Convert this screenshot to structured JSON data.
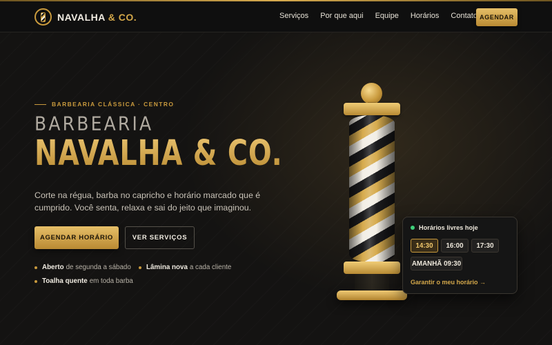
{
  "brand": {
    "name": "NAVALHA",
    "amp": "& CO.",
    "logo_icon": "barber-pole-icon"
  },
  "nav": {
    "links": [
      "Serviços",
      "Por que aqui",
      "Equipe",
      "Horários",
      "Contato"
    ],
    "cta": "AGENDAR"
  },
  "hero": {
    "eyebrow": "BARBEARIA CLÁSSICA · CENTRO",
    "title_small": "BARBEARIA",
    "title_big": "NAVALHA & CO.",
    "lead": "Corte na régua, barba no capricho e horário marcado que é cumprido. Você senta, relaxa e sai do jeito que imaginou.",
    "primary_button": "AGENDAR HORÁRIO",
    "secondary_button": "VER SERVIÇOS",
    "features": [
      {
        "strong": "Aberto",
        "text": "de segunda a sábado"
      },
      {
        "strong": "Lâmina nova",
        "text": "a cada cliente"
      },
      {
        "strong": "Toalha quente",
        "text": "em toda barba"
      }
    ]
  },
  "availability": {
    "title": "Horários livres hoje",
    "slots": [
      "14:30",
      "16:00",
      "17:30",
      "AMANHÃ 09:30"
    ],
    "selected": "14:30",
    "link": "Garantir o meu horário →"
  },
  "colors": {
    "accent": "#d4a84a",
    "background": "#141312",
    "live": "#3fd07a"
  }
}
